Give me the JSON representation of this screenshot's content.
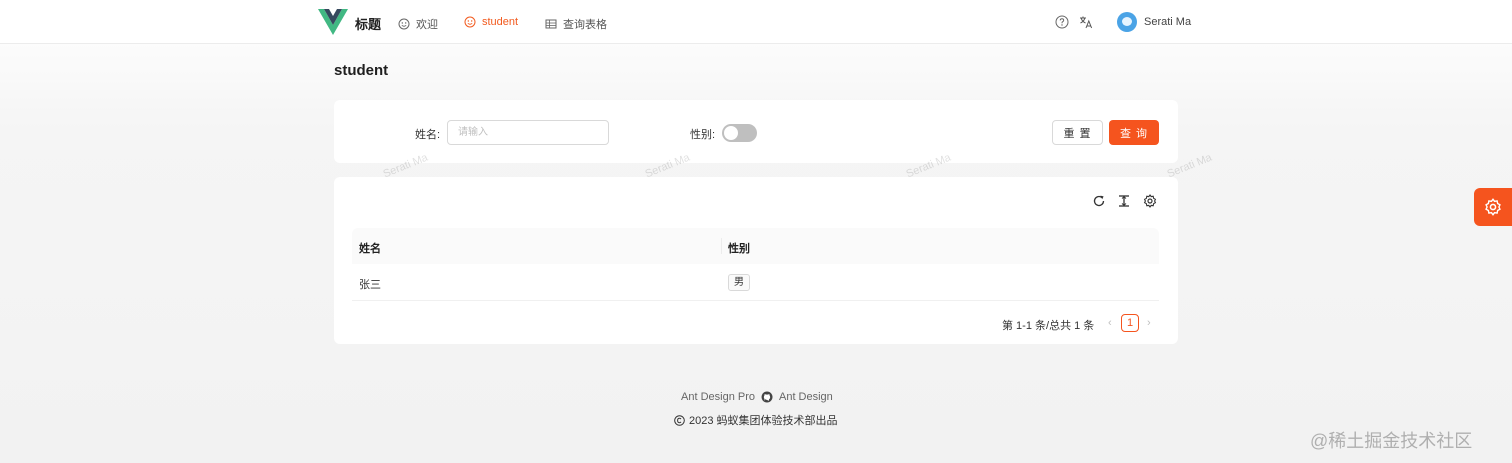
{
  "header": {
    "title": "标题",
    "nav": [
      {
        "label": "欢迎",
        "icon": "smile-icon"
      },
      {
        "label": "student",
        "icon": "smile-icon",
        "active": true
      },
      {
        "label": "查询表格",
        "icon": "table-icon"
      }
    ],
    "user_name": "Serati Ma"
  },
  "page": {
    "title": "student"
  },
  "search": {
    "name_label": "姓名:",
    "name_placeholder": "请输入",
    "gender_label": "性别:",
    "gender_switch_on": false,
    "reset_label": "重 置",
    "query_label": "查 询"
  },
  "table": {
    "columns": [
      "姓名",
      "性别"
    ],
    "rows": [
      {
        "name": "张三",
        "gender": "男"
      }
    ],
    "pagination": {
      "total_text": "第 1-1 条/总共 1 条",
      "current_page": "1"
    }
  },
  "watermark": "Serati Ma",
  "footer": {
    "link_left": "Ant Design Pro",
    "link_right": "Ant Design",
    "copyright": "2023 蚂蚁集团体验技术部出品"
  },
  "corner_watermark": "@稀土掘金技术社区",
  "colors": {
    "primary": "#f5541e",
    "vue_green": "#41b883",
    "vue_dark": "#35495e"
  }
}
